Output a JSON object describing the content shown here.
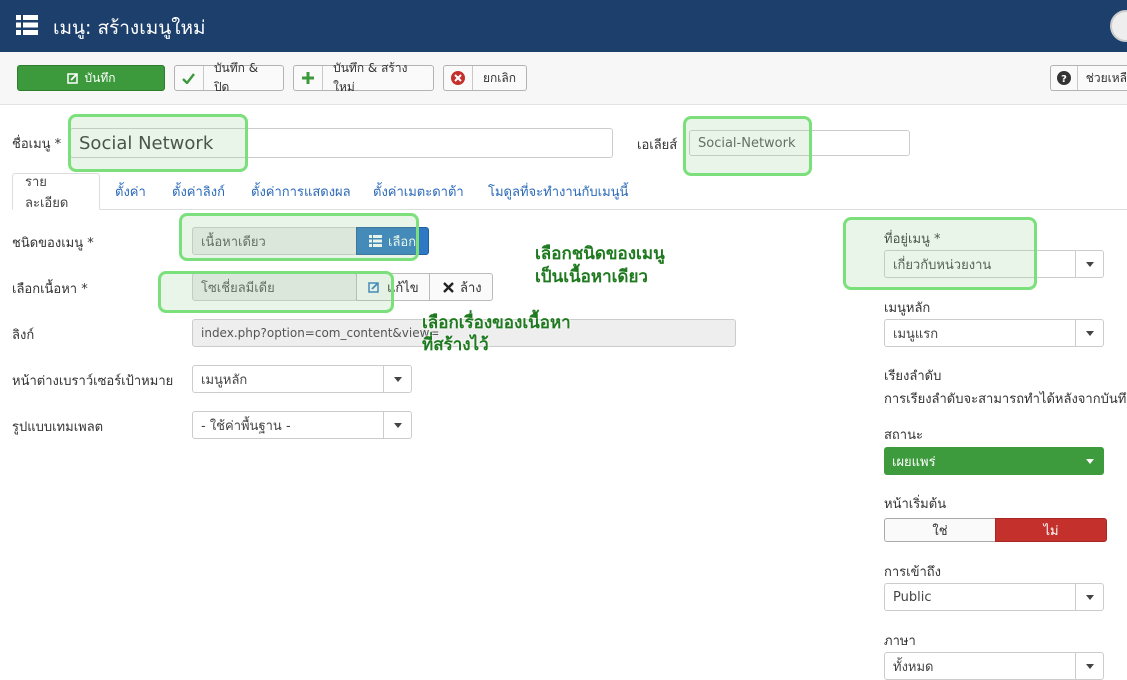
{
  "header": {
    "title": "เมนู: สร้างเมนูใหม่",
    "menu_icon": "grid-list-icon"
  },
  "toolbar": {
    "save": "บันทึก",
    "save_close": "บันทึก & ปิด",
    "save_new": "บันทึก & สร้างใหม่",
    "cancel": "ยกเลิก",
    "help": "ช่วยเหลื"
  },
  "title_field": {
    "label": "ชื่อเมนู *",
    "value": "Social Network"
  },
  "alias_field": {
    "label": "เอเลียส์",
    "value": "Social-Network"
  },
  "tabs": [
    "รายละเอียด",
    "ตั้งค่า",
    "ตั้งค่าลิงก์",
    "ตั้งค่าการแสดงผล",
    "ตั้งค่าเมตะดาต้า",
    "โมดูลที่จะทำงานกับเมนูนี้"
  ],
  "details": {
    "menu_type": {
      "label": "ชนิดของเมนู *",
      "value": "เนื้อหาเดียว",
      "button": "เลือก"
    },
    "select_content": {
      "label": "เลือกเนื้อหา *",
      "value": "โซเชี่ยลมีเดีย",
      "edit": "แก้ไข",
      "clear": "ล้าง"
    },
    "link": {
      "label": "ลิงก์",
      "value": "index.php?option=com_content&view="
    },
    "target_window": {
      "label": "หน้าต่างเบราว์เซอร์เป้าหมาย",
      "value": "เมนูหลัก"
    },
    "template_style": {
      "label": "รูปแบบเทมเพลต",
      "value": "- ใช้ค่าพื้นฐาน -"
    }
  },
  "side": {
    "menu_location": {
      "label": "ที่อยู่เมนู *",
      "value": "เกี่ยวกับหน่วยงาน"
    },
    "parent_item": {
      "label": "เมนูหลัก",
      "value": "เมนูแรก"
    },
    "ordering": {
      "label": "เรียงลำดับ",
      "note": "การเรียงลำดับจะสามารถทำได้หลังจากบันทึกแ"
    },
    "status": {
      "label": "สถานะ",
      "value": "เผยแพร่"
    },
    "default_page": {
      "label": "หน้าเริ่มต้น",
      "yes": "ใช่",
      "no": "ไม่"
    },
    "access": {
      "label": "การเข้าถึง",
      "value": "Public"
    },
    "language": {
      "label": "ภาษา",
      "value": "ทั้งหมด"
    }
  },
  "annotations": {
    "menu_type_note_1": "เลือกชนิดของเมนู",
    "menu_type_note_2": "เป็นเนื้อหาเดียว",
    "content_note_1": "เลือกเรื่องของเนื้อหา",
    "content_note_2": "ที่สร้างไว้"
  },
  "colors": {
    "header_bg": "#1d3f6c",
    "save_green": "#3c9a3c",
    "select_blue": "#2f78c4",
    "no_red": "#c4302b",
    "highlight": "#7be07b"
  }
}
